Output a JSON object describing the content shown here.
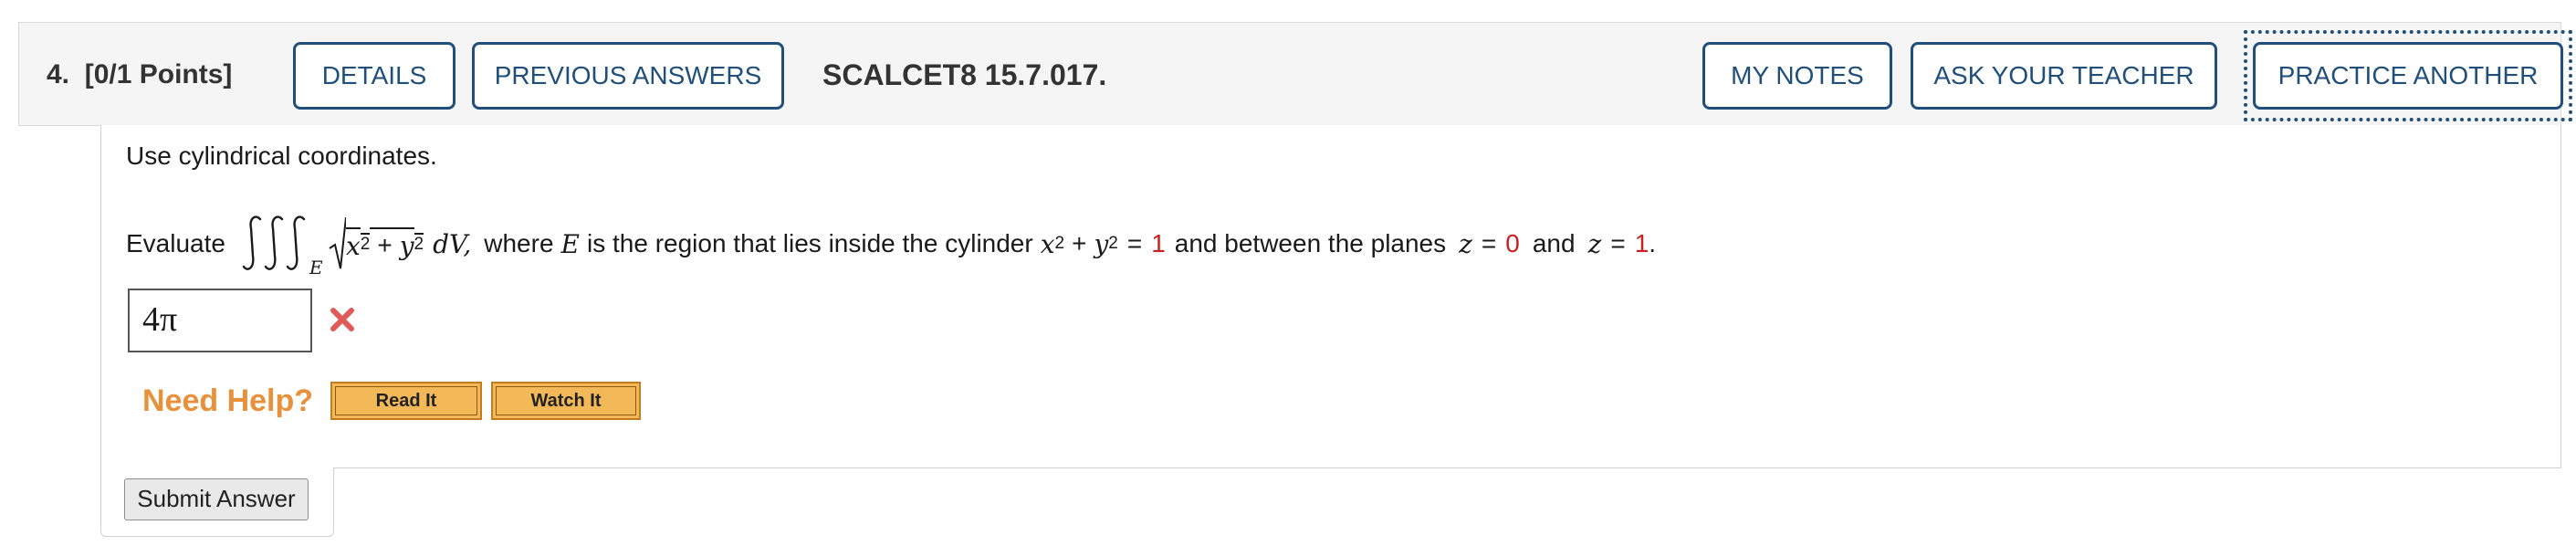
{
  "header": {
    "question_number": "4.",
    "points": "[0/1 Points]",
    "details_label": "DETAILS",
    "previous_answers_label": "PREVIOUS ANSWERS",
    "problem_code": "SCALCET8 15.7.017.",
    "my_notes_label": "MY NOTES",
    "ask_teacher_label": "ASK YOUR TEACHER",
    "practice_another_label": "PRACTICE ANOTHER"
  },
  "question": {
    "instruction": "Use cylindrical coordinates.",
    "evaluate_label": "Evaluate",
    "region_subscript": "E",
    "integrand_x": "x",
    "integrand_y": "y",
    "exponent": "2",
    "plus": "+",
    "differential": "dV,",
    "where_text": "where",
    "region_var": "E",
    "region_text": "is the region that lies inside the cylinder",
    "equals": "=",
    "cylinder_value": "1",
    "planes_text": "and between the planes",
    "z_var": "z",
    "plane1_value": "0",
    "and_text": "and",
    "plane2_value": "1",
    "period": "."
  },
  "answer": {
    "value": "4π",
    "status": "incorrect"
  },
  "help": {
    "need_help_label": "Need Help?",
    "read_it_label": "Read It",
    "watch_it_label": "Watch It"
  },
  "submit": {
    "label": "Submit Answer"
  },
  "colors": {
    "accent": "#1f4f7a",
    "incorrect": "#e05a5a",
    "help_orange": "#e8913a",
    "red_value": "#cc1f1f"
  }
}
